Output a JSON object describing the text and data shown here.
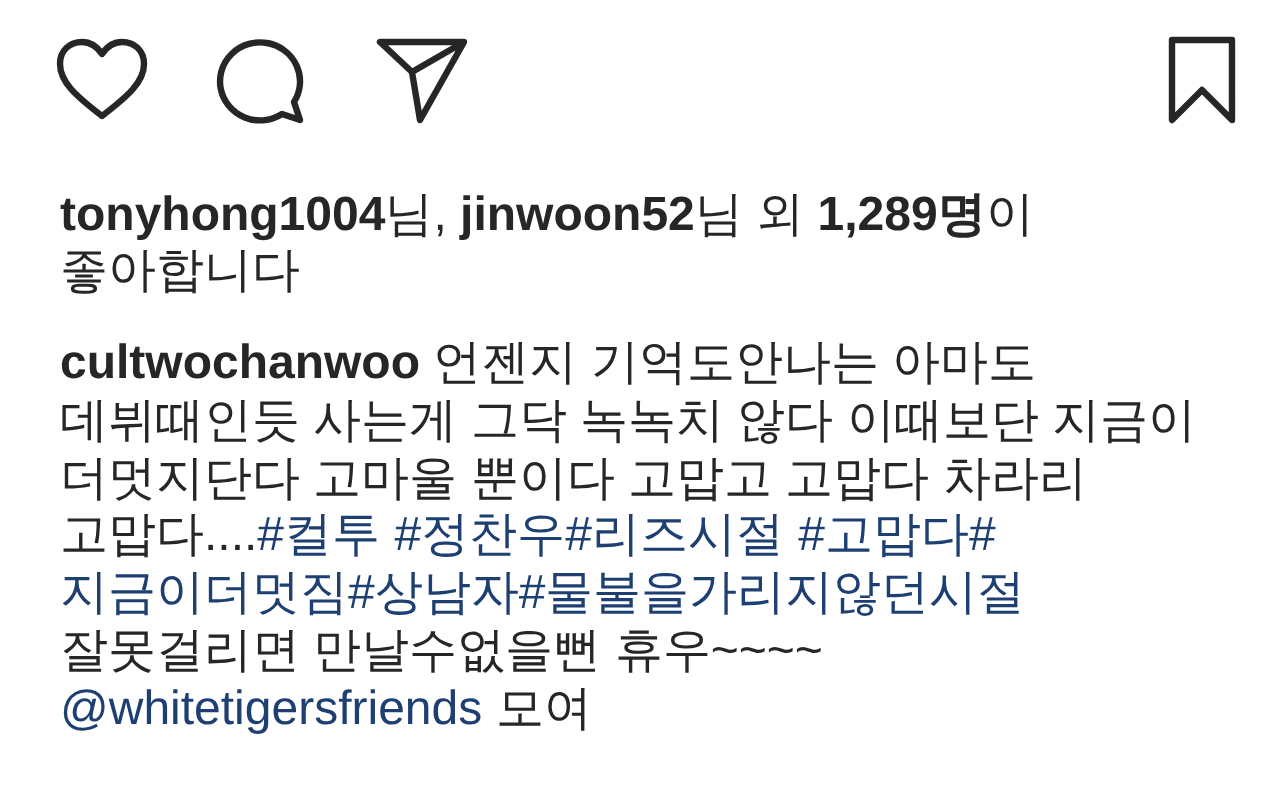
{
  "likes": {
    "text": "**tonyhong1004**님, **jinwoon52**님 외 **1,289명**이 좋아합니다"
  },
  "caption": {
    "lines": [
      [
        {
          "kind": "user",
          "text": "cultwochanwoo"
        },
        {
          "kind": "text",
          "text": " 언젠지 기억도안나는 아마도"
        }
      ],
      [
        {
          "kind": "text",
          "text": "데뷔때인듯 사는게 그닥 녹녹치 않다 이때보단 지금이"
        }
      ],
      [
        {
          "kind": "text",
          "text": "더멋지단다 고마울 뿐이다 고맙고 고맙다 차라리"
        }
      ],
      [
        {
          "kind": "text",
          "text": "고맙다...."
        },
        {
          "kind": "hashtag",
          "text": "#컬투"
        },
        {
          "kind": "hashtag",
          "text": "#정찬우",
          "gap_before": true
        },
        {
          "kind": "hashtag",
          "text": "#리즈시절"
        },
        {
          "kind": "hashtag",
          "text": "#고맙다#",
          "gap_before": true
        }
      ],
      [
        {
          "kind": "hashtag",
          "text": "지금이더멋짐"
        },
        {
          "kind": "hashtag",
          "text": "#상남자"
        },
        {
          "kind": "hashtag",
          "text": "#물불을가리지않던시절"
        }
      ],
      [
        {
          "kind": "text",
          "text": "잘못걸리면 만날수없을뻔 휴우~~~~"
        }
      ],
      [
        {
          "kind": "mention",
          "text": "@whitetigersfriends"
        },
        {
          "kind": "text",
          "text": " 모여"
        }
      ]
    ]
  }
}
